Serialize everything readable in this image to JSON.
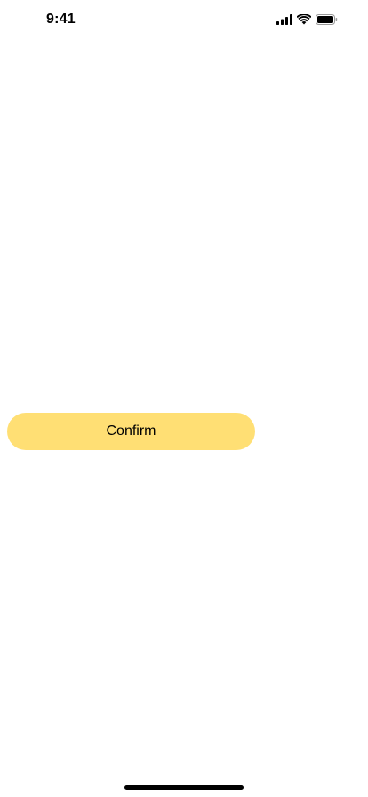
{
  "status_bar": {
    "time": "9:41",
    "icons": [
      "cellular-signal-icon",
      "wifi-icon",
      "battery-icon"
    ]
  },
  "main": {
    "confirm_label": "Confirm"
  },
  "colors": {
    "button_background": "#ffdf74",
    "button_text": "#000000",
    "background": "#ffffff"
  }
}
